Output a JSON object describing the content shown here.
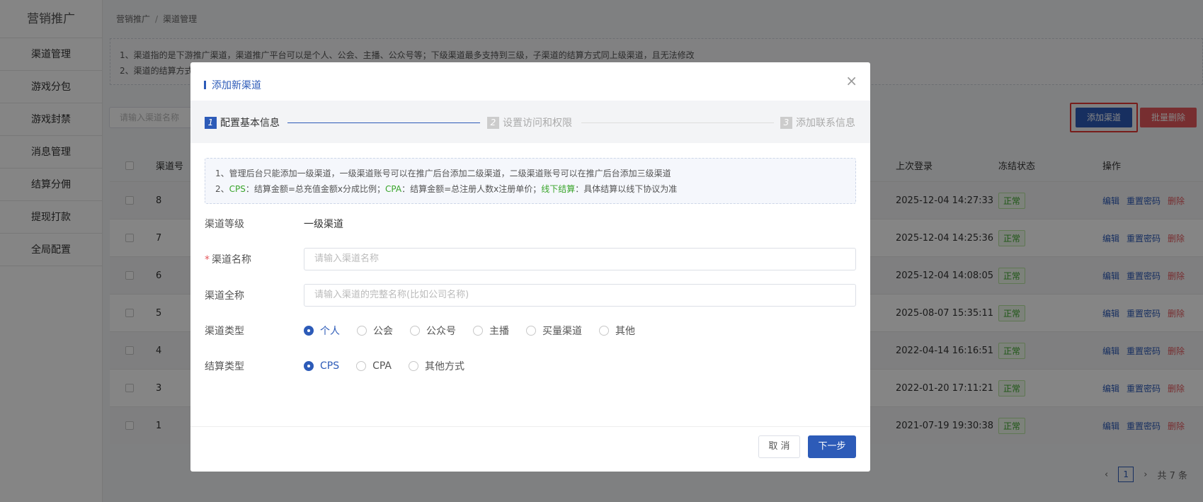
{
  "sidebar": {
    "title": "营销推广",
    "items": [
      {
        "label": "渠道管理"
      },
      {
        "label": "游戏分包"
      },
      {
        "label": "游戏封禁"
      },
      {
        "label": "消息管理"
      },
      {
        "label": "结算分佣"
      },
      {
        "label": "提现打款"
      },
      {
        "label": "全局配置"
      }
    ]
  },
  "breadcrumb": {
    "parent": "营销推广",
    "current": "渠道管理"
  },
  "notice": {
    "line1": "1、渠道指的是下游推广渠道，渠道推广平台可以是个人、公会、主播、公众号等；下级渠道最多支持到三级，子渠道的结算方式同上级渠道，且无法修改",
    "line2": "2、渠道的结算方式"
  },
  "toolbar": {
    "search_placeholder": "请输入渠道名称",
    "add_label": "添加渠道",
    "batch_delete_label": "批量删除"
  },
  "table": {
    "headers": {
      "id": "渠道号",
      "last_login": "上次登录",
      "status": "冻结状态",
      "ops": "操作"
    },
    "rows": [
      {
        "id": "8",
        "last_login": "2025-12-04 14:27:33",
        "status": "正常"
      },
      {
        "id": "7",
        "last_login": "2025-12-04 14:25:36",
        "status": "正常"
      },
      {
        "id": "6",
        "last_login": "2025-12-04 14:08:05",
        "status": "正常"
      },
      {
        "id": "5",
        "last_login": "2025-08-07 15:35:11",
        "status": "正常"
      },
      {
        "id": "4",
        "last_login": "2022-04-14 16:16:51",
        "status": "正常"
      },
      {
        "id": "3",
        "last_login": "2022-01-20 17:11:21",
        "status": "正常"
      },
      {
        "id": "1",
        "last_login": "2021-07-19 19:30:38",
        "status": "正常"
      }
    ],
    "op_edit": "编辑",
    "op_reset": "重置密码",
    "op_delete": "删除"
  },
  "pagination": {
    "prev": "‹",
    "current": "1",
    "next": "›",
    "total": "共 7 条"
  },
  "modal": {
    "title": "添加新渠道",
    "close": "×",
    "steps": [
      {
        "num": "1",
        "label": "配置基本信息"
      },
      {
        "num": "2",
        "label": "设置访问和权限"
      },
      {
        "num": "3",
        "label": "添加联系信息"
      }
    ],
    "tip": {
      "line1": "1、管理后台只能添加一级渠道，一级渠道账号可以在推广后台添加二级渠道，二级渠道账号可以在推广后台添加三级渠道",
      "line2_prefix": "2、",
      "cps_label": "CPS",
      "cps_text": "：结算金额=总充值金额x分成比例；",
      "cpa_label": "CPA",
      "cpa_text": "：结算金额=总注册人数x注册单价；",
      "offline_label": "线下结算",
      "offline_text": "：具体结算以线下协议为准"
    },
    "form": {
      "level_label": "渠道等级",
      "level_value": "一级渠道",
      "name_label": "渠道名称",
      "name_required": "*",
      "name_placeholder": "请输入渠道名称",
      "fullname_label": "渠道全称",
      "fullname_placeholder": "请输入渠道的完整名称(比如公司名称)",
      "type_label": "渠道类型",
      "type_options": [
        "个人",
        "公会",
        "公众号",
        "主播",
        "买量渠道",
        "其他"
      ],
      "type_selected": "个人",
      "settle_label": "结算类型",
      "settle_options": [
        "CPS",
        "CPA",
        "其他方式"
      ],
      "settle_selected": "CPS"
    },
    "cancel_label": "取 消",
    "next_label": "下一步"
  },
  "colors": {
    "primary": "#2d5bb8",
    "danger": "#e5585d",
    "success": "#3aa52b",
    "highlight": "#e53935"
  }
}
